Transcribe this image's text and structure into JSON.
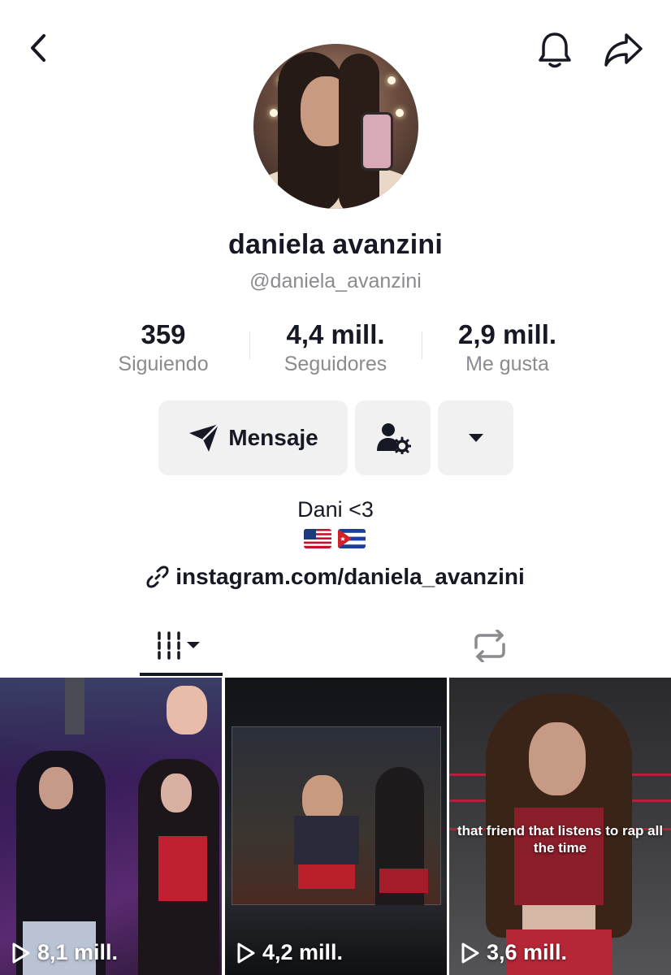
{
  "profile": {
    "display_name": "daniela avanzini",
    "username": "@daniela_avanzini"
  },
  "stats": {
    "following": {
      "value": "359",
      "label": "Siguiendo"
    },
    "followers": {
      "value": "4,4 mill.",
      "label": "Seguidores"
    },
    "likes": {
      "value": "2,9 mill.",
      "label": "Me gusta"
    }
  },
  "actions": {
    "message_label": "Mensaje"
  },
  "bio": {
    "text": "Dani <3",
    "flags": [
      "flag-usa",
      "flag-cuba"
    ],
    "link": "instagram.com/daniela_avanzini"
  },
  "icons": {
    "back": "chevron-left-icon",
    "bell": "bell-icon",
    "share": "share-arrow-icon",
    "message": "paper-plane-icon",
    "friend_settings": "user-gear-icon",
    "more": "caret-down-icon",
    "link": "link-icon",
    "videos_tab": "grid-columns-icon",
    "reposts_tab": "repost-icon",
    "play": "play-outline-icon"
  },
  "videos": [
    {
      "views": "8,1 mill.",
      "overlay": ""
    },
    {
      "views": "4,2 mill.",
      "overlay": ""
    },
    {
      "views": "3,6 mill.",
      "overlay": "that friend that listens to rap all the time"
    }
  ],
  "colors": {
    "text": "#161823",
    "secondary_text": "#8a8b91",
    "button_bg": "#f1f1f2"
  }
}
